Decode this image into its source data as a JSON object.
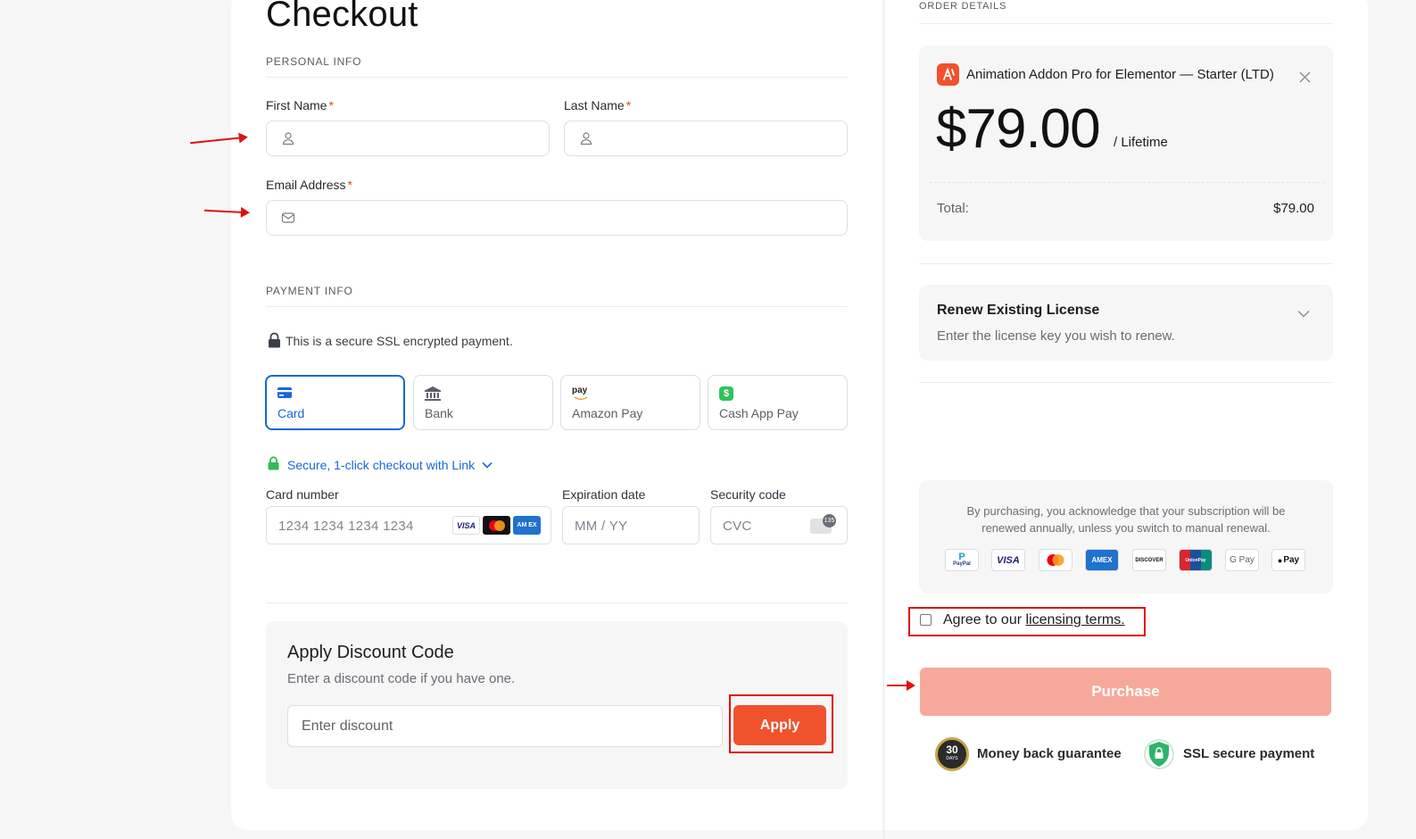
{
  "page": {
    "title": "Checkout",
    "personal_section": "PERSONAL INFO",
    "payment_section": "PAYMENT INFO",
    "order_section": "ORDER DETAILS"
  },
  "personal": {
    "first_name_label": "First Name",
    "last_name_label": "Last Name",
    "email_label": "Email Address",
    "required_mark": "*"
  },
  "payment": {
    "ssl_note": "This is a secure SSL encrypted payment.",
    "methods": [
      {
        "label": "Card",
        "icon": "card-icon",
        "active": true
      },
      {
        "label": "Bank",
        "icon": "bank-icon",
        "active": false
      },
      {
        "label": "Amazon Pay",
        "icon": "amazon-pay-icon",
        "active": false,
        "icon_text": "pay"
      },
      {
        "label": "Cash App Pay",
        "icon": "cash-app-icon",
        "active": false,
        "icon_text": "$"
      }
    ],
    "link_text": "Secure, 1-click checkout with Link",
    "card_number_label": "Card number",
    "card_number_placeholder": "1234 1234 1234 1234",
    "expiry_label": "Expiration date",
    "expiry_placeholder": "MM / YY",
    "cvc_label": "Security code",
    "cvc_placeholder": "CVC",
    "cvc_badge": "135",
    "card_brands": [
      "VISA",
      "AM EX"
    ]
  },
  "discount": {
    "title": "Apply Discount Code",
    "subtitle": "Enter a discount code if you have one.",
    "placeholder": "Enter discount",
    "button": "Apply"
  },
  "order": {
    "product_name": "Animation Addon Pro for Elementor — Starter (LTD)",
    "price": "$79.00",
    "period": "/ Lifetime",
    "total_label": "Total:",
    "total_value": "$79.00",
    "renew_title": "Renew Existing License",
    "renew_subtitle": "Enter the license key you wish to renew.",
    "disclaimer": "By purchasing, you acknowledge that your subscription will be renewed annually, unless you switch to manual renewal.",
    "payment_logos": [
      "PayPal",
      "VISA",
      "Mastercard",
      "AMEX",
      "DISCOVER",
      "UnionPay",
      "G Pay",
      "Pay"
    ],
    "agree_prefix": "Agree to our",
    "agree_link": "licensing terms.",
    "agree_checked": false,
    "purchase_button": "Purchase",
    "badge_30_top": "30",
    "badge_30_bottom": "DAYS",
    "guarantee": "Money back guarantee",
    "ssl": "SSL secure payment"
  },
  "colors": {
    "accent": "#f0522d",
    "link_blue": "#1768d9",
    "purchase_disabled": "#f6a99a",
    "annotation_red": "#e01010",
    "lock_green": "#33b857"
  }
}
